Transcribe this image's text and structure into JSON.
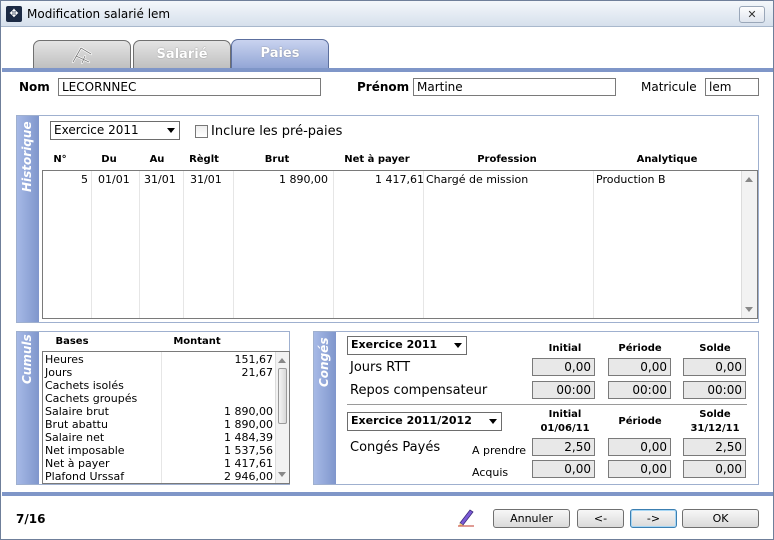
{
  "window": {
    "title": "Modification salarié lem",
    "close": "✕"
  },
  "tabs": [
    {
      "label": ""
    },
    {
      "label": "Salarié"
    },
    {
      "label": "Paies"
    }
  ],
  "employee": {
    "nom_label": "Nom",
    "nom": "LECORNNEC",
    "prenom_label": "Prénom",
    "prenom": "Martine",
    "matricule_label": "Matricule",
    "matricule": "lem"
  },
  "historique": {
    "title": "Historique",
    "exercice": "Exercice 2011",
    "include_label": "Inclure les pré-paies",
    "columns": [
      "N°",
      "Du",
      "Au",
      "Règlt",
      "Brut",
      "Net à payer",
      "Profession",
      "Analytique"
    ],
    "rows": [
      {
        "num": "5",
        "du": "01/01",
        "au": "31/01",
        "reglt": "31/01",
        "brut": "1 890,00",
        "net": "1 417,61",
        "profession": "Chargé de mission",
        "analytique": "Production B"
      }
    ]
  },
  "cumuls": {
    "title": "Cumuls",
    "columns": [
      "Bases",
      "Montant"
    ],
    "rows": [
      {
        "base": "Heures",
        "montant": "151,67"
      },
      {
        "base": "Jours",
        "montant": "21,67"
      },
      {
        "base": "Cachets isolés",
        "montant": ""
      },
      {
        "base": "Cachets groupés",
        "montant": ""
      },
      {
        "base": "Salaire brut",
        "montant": "1 890,00"
      },
      {
        "base": "Brut abattu",
        "montant": "1 890,00"
      },
      {
        "base": "Salaire net",
        "montant": "1 484,39"
      },
      {
        "base": "Net imposable",
        "montant": "1 537,56"
      },
      {
        "base": "Net à payer",
        "montant": "1 417,61"
      },
      {
        "base": "Plafond Urssaf",
        "montant": "2 946,00"
      }
    ]
  },
  "conges": {
    "title": "Congés",
    "ex1": "Exercice 2011",
    "headers1": {
      "initial": "Initial",
      "periode": "Période",
      "solde": "Solde"
    },
    "rtt": {
      "label": "Jours RTT",
      "initial": "0,00",
      "periode": "0,00",
      "solde": "0,00"
    },
    "repos": {
      "label": "Repos compensateur",
      "initial": "00:00",
      "periode": "00:00",
      "solde": "00:00"
    },
    "ex2": "Exercice 2011/2012",
    "headers2": {
      "initial": "Initial",
      "initial_date": "01/06/11",
      "periode": "Période",
      "solde": "Solde",
      "solde_date": "31/12/11"
    },
    "cp_label": "Congés Payés",
    "aprendre": {
      "label": "A prendre",
      "initial": "2,50",
      "periode": "0,00",
      "solde": "2,50"
    },
    "acquis": {
      "label": "Acquis",
      "initial": "0,00",
      "periode": "0,00",
      "solde": "0,00"
    }
  },
  "footer": {
    "counter": "7/16",
    "annuler": "Annuler",
    "prev": "<-",
    "next": "->",
    "ok": "OK"
  },
  "colors": {
    "accent": "#7f96c8",
    "tab_active": "#8fa3d4"
  }
}
